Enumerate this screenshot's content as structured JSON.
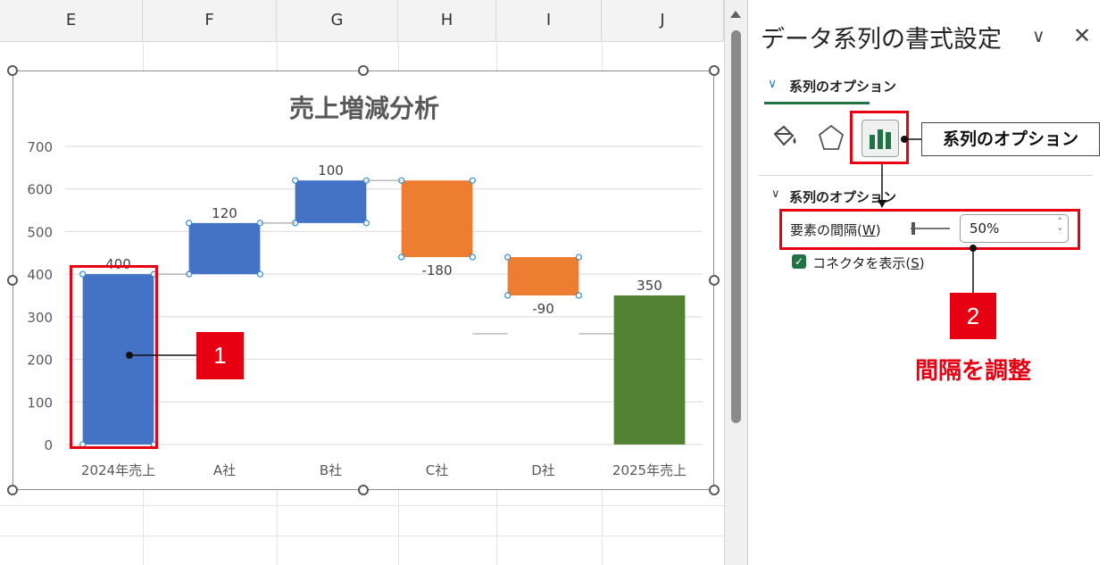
{
  "sheet": {
    "columns": [
      "E",
      "F",
      "G",
      "H",
      "I",
      "J"
    ]
  },
  "chart_data": {
    "type": "bar",
    "subtype": "waterfall",
    "title": "売上増減分析",
    "categories": [
      "2024年売上",
      "A社",
      "B社",
      "C社",
      "D社",
      "2025年売上"
    ],
    "values": [
      400,
      120,
      100,
      -180,
      -90,
      350
    ],
    "data_labels": [
      "400",
      "120",
      "100",
      "-180",
      "-90",
      "350"
    ],
    "bases": [
      0,
      400,
      520,
      440,
      350,
      0
    ],
    "kinds": [
      "total",
      "increase",
      "increase",
      "decrease",
      "decrease",
      "total"
    ],
    "ylim": [
      0,
      700
    ],
    "yticks": [
      "0",
      "100",
      "200",
      "300",
      "400",
      "500",
      "600",
      "700"
    ],
    "grid": true,
    "colors": {
      "increase": "#4472c4",
      "decrease": "#ed7d31",
      "total_start": "#4472c4",
      "total_end": "#548235"
    }
  },
  "pane": {
    "title": "データ系列の書式設定",
    "tab_label": "系列のオプション",
    "section_title": "系列のオプション",
    "gap_label": "要素の間隔(",
    "gap_key": "W",
    "gap_close": ")",
    "gap_value": "50%",
    "connector_label": "コネクタを表示(",
    "connector_key": "S",
    "connector_close": ")",
    "connector_checked": true
  },
  "annotations": {
    "badge1": "1",
    "badge2": "2",
    "tip": "系列のオプション",
    "adjust": "間隔を調整"
  },
  "icons": {
    "fill": "paint-bucket-icon",
    "effects": "pentagon-icon",
    "series_options": "bar-chart-icon"
  }
}
